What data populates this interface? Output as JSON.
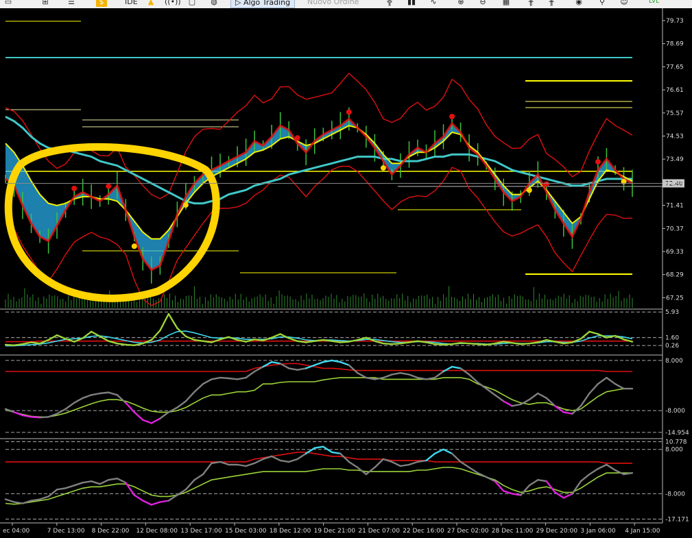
{
  "toolbar": {
    "items": [
      {
        "name": "layout-icon",
        "glyph": "▭"
      },
      {
        "name": "chart-type-icon",
        "glyph": "⊞"
      },
      {
        "name": "database-icon",
        "glyph": "☰"
      },
      {
        "name": "dollar-icon",
        "glyph": "$"
      },
      {
        "name": "ide-button",
        "label": "IDE"
      },
      {
        "name": "lightbulb-icon",
        "glyph": "▲"
      },
      {
        "name": "signal-icon",
        "glyph": "((•))"
      },
      {
        "name": "monitor-icon",
        "glyph": "▢"
      },
      {
        "name": "globe-icon",
        "glyph": "◍"
      },
      {
        "name": "algo-trading-button",
        "label": "▷ Algo Trading"
      },
      {
        "name": "new-order-button",
        "label": "Nuovo Ordine"
      },
      {
        "name": "bar-chart-icon",
        "glyph": "╬"
      },
      {
        "name": "candles-icon",
        "glyph": "▮▮"
      },
      {
        "name": "line-chart-icon",
        "glyph": "∿"
      },
      {
        "name": "zoom-in-icon",
        "glyph": "⊕"
      },
      {
        "name": "zoom-out-icon",
        "glyph": "⊖"
      },
      {
        "name": "tile-icon",
        "glyph": "▦"
      },
      {
        "name": "indicators-icon",
        "glyph": "╫"
      },
      {
        "name": "periods-icon",
        "glyph": "╫"
      },
      {
        "name": "camera-icon",
        "glyph": "◉"
      },
      {
        "name": "search-icon",
        "glyph": "⚲"
      },
      {
        "name": "avatar-icon",
        "glyph": "☺"
      },
      {
        "name": "lvl-label",
        "label": "LVL"
      }
    ]
  },
  "chart_data": [
    {
      "type": "line",
      "pane": "price",
      "y_ticks": [
        "79.73",
        "78.69",
        "77.65",
        "76.61",
        "75.57",
        "74.53",
        "73.49",
        "72.45",
        "71.41",
        "70.37",
        "69.33",
        "68.29",
        "67.25"
      ],
      "current_price": "72.40",
      "ylim": [
        66.8,
        80.1
      ],
      "colors": {
        "price": "#d8d800",
        "envelope": "#e01010",
        "ma_slow": "#40c8c8",
        "ma_fast": "#f0f000",
        "dots": "#e01010",
        "annotation": "#ffd400",
        "volume": "#2e8b2e"
      },
      "series": [
        {
          "values": [
            72.6,
            72.3,
            71.4,
            70.6,
            70.0,
            69.8,
            70.5,
            71.2,
            71.8,
            72.0,
            71.8,
            71.6,
            71.9,
            72.3,
            71.2,
            70.0,
            69.0,
            68.5,
            68.7,
            69.8,
            71.0,
            71.8,
            72.4,
            72.8,
            73.0,
            73.2,
            73.4,
            73.6,
            73.8,
            74.3,
            74.1,
            74.5,
            75.0,
            74.8,
            74.2,
            73.8,
            74.3,
            74.6,
            74.8,
            75.0,
            75.3,
            74.9,
            74.5,
            74.0,
            73.4,
            72.8,
            73.2,
            73.7,
            74.0,
            73.8,
            74.2,
            74.5,
            75.1,
            74.7,
            74.0,
            73.7,
            73.2,
            72.6,
            72.0,
            71.6,
            71.8,
            72.4,
            72.8,
            72.0,
            71.2,
            70.6,
            70.0,
            70.8,
            72.0,
            73.0,
            73.5,
            73.0,
            72.6,
            72.4
          ]
        },
        {
          "values": [
            75.4,
            75.2,
            74.9,
            74.5,
            74.2,
            74.0,
            73.9,
            73.9,
            73.8,
            73.7,
            73.6,
            73.4,
            73.3,
            73.2,
            73.0,
            72.8,
            72.6,
            72.4,
            72.2,
            72.0,
            71.8,
            71.6,
            71.5,
            71.5,
            71.6,
            71.7,
            71.9,
            72.0,
            72.1,
            72.3,
            72.4,
            72.5,
            72.6,
            72.8,
            72.9,
            73.0,
            73.1,
            73.2,
            73.3,
            73.4,
            73.5,
            73.6,
            73.6,
            73.6,
            73.5,
            73.5,
            73.4,
            73.4,
            73.4,
            73.5,
            73.6,
            73.6,
            73.7,
            73.7,
            73.7,
            73.6,
            73.5,
            73.4,
            73.2,
            73.0,
            72.9,
            72.8,
            72.7,
            72.6,
            72.5,
            72.4,
            72.3,
            72.3,
            72.4,
            72.5,
            72.6,
            72.6,
            72.6,
            72.6
          ]
        },
        {
          "values": [
            74.2,
            73.8,
            73.2,
            72.5,
            71.9,
            71.5,
            71.4,
            71.5,
            71.7,
            71.8,
            71.8,
            71.7,
            71.7,
            71.6,
            71.2,
            70.7,
            70.2,
            69.9,
            69.9,
            70.3,
            70.9,
            71.5,
            72.0,
            72.4,
            72.7,
            72.9,
            73.1,
            73.3,
            73.5,
            73.8,
            73.9,
            74.1,
            74.4,
            74.5,
            74.3,
            74.1,
            74.2,
            74.4,
            74.6,
            74.8,
            75.0,
            74.9,
            74.6,
            74.2,
            73.7,
            73.3,
            73.3,
            73.6,
            73.8,
            73.8,
            74.0,
            74.3,
            74.7,
            74.6,
            74.1,
            73.8,
            73.3,
            72.8,
            72.3,
            71.9,
            71.9,
            72.2,
            72.5,
            72.1,
            71.6,
            71.1,
            70.6,
            70.9,
            71.7,
            72.5,
            73.0,
            72.9,
            72.7,
            72.5
          ]
        }
      ]
    },
    {
      "type": "line",
      "pane": "indicator-1",
      "y_ticks": [
        "5.93",
        "1.60",
        "0.26"
      ],
      "ylim": [
        -1.0,
        6.3
      ],
      "series": [
        {
          "values": [
            0.4,
            0.3,
            0.5,
            0.8,
            0.6,
            1.2,
            2.0,
            1.4,
            0.9,
            1.5,
            2.6,
            1.8,
            1.0,
            0.6,
            0.4,
            0.3,
            0.6,
            1.2,
            2.8,
            5.6,
            3.2,
            1.8,
            1.2,
            1.0,
            0.8,
            1.3,
            1.7,
            1.2,
            0.9,
            1.3,
            1.1,
            1.6,
            2.2,
            1.5,
            1.0,
            0.8,
            1.0,
            1.2,
            1.0,
            0.8,
            0.9,
            1.2,
            1.6,
            1.0,
            0.6,
            0.5,
            0.6,
            0.8,
            1.0,
            0.8,
            0.5,
            0.4,
            0.5,
            0.7,
            0.6,
            0.5,
            0.4,
            0.6,
            0.9,
            0.7,
            0.5,
            0.6,
            0.8,
            1.2,
            0.9,
            0.6,
            0.8,
            1.4,
            2.6,
            2.2,
            1.6,
            1.9,
            1.3,
            0.9
          ]
        },
        {
          "values": [
            0.2,
            0.2,
            0.3,
            0.4,
            0.5,
            0.7,
            1.0,
            1.3,
            1.4,
            1.5,
            1.8,
            1.9,
            1.7,
            1.4,
            1.1,
            0.8,
            0.7,
            0.8,
            1.2,
            2.0,
            2.6,
            2.7,
            2.4,
            2.0,
            1.6,
            1.5,
            1.6,
            1.5,
            1.3,
            1.3,
            1.3,
            1.4,
            1.7,
            1.7,
            1.5,
            1.2,
            1.1,
            1.2,
            1.2,
            1.1,
            1.0,
            1.1,
            1.3,
            1.3,
            1.1,
            0.9,
            0.8,
            0.8,
            0.9,
            0.9,
            0.8,
            0.6,
            0.5,
            0.6,
            0.6,
            0.6,
            0.5,
            0.5,
            0.6,
            0.7,
            0.6,
            0.6,
            0.7,
            0.9,
            0.9,
            0.8,
            0.8,
            1.0,
            1.5,
            1.9,
            1.9,
            1.9,
            1.7,
            1.4
          ]
        },
        {
          "values": [
            0.9,
            0.9,
            0.9,
            0.9,
            1.0,
            1.0,
            1.0,
            1.0,
            1.0,
            1.0,
            1.0,
            1.0,
            1.0,
            1.0,
            1.0,
            1.0,
            1.0,
            1.0,
            1.0,
            1.0,
            1.0,
            1.0,
            1.0,
            1.0,
            1.0,
            1.0,
            1.0,
            1.0,
            1.0,
            1.0,
            1.0,
            1.0,
            1.0,
            1.0,
            1.0,
            1.0,
            1.0,
            1.0,
            1.0,
            1.0,
            1.0,
            1.0,
            1.0,
            1.0,
            1.0,
            1.0,
            1.0,
            1.0,
            1.0,
            1.0,
            1.0,
            1.0,
            1.0,
            1.0,
            1.0,
            1.0,
            1.0,
            1.0,
            1.0,
            1.0,
            1.0,
            1.0,
            1.0,
            1.0,
            1.0,
            1.0,
            1.0,
            1.0,
            1.0,
            1.0,
            1.0,
            1.0,
            1.0,
            1.0
          ]
        }
      ]
    },
    {
      "type": "line",
      "pane": "indicator-2",
      "y_ticks": [
        "8.000",
        "-8.000",
        "-14.954"
      ],
      "ylim": [
        -16.5,
        9.3
      ],
      "series": [
        {
          "values": [
            -7.5,
            -8.5,
            -9.5,
            -10.0,
            -10.2,
            -10.0,
            -9.0,
            -7.5,
            -5.5,
            -4.0,
            -3.0,
            -2.5,
            -2.2,
            -3.0,
            -5.5,
            -8.5,
            -11.0,
            -12.0,
            -10.5,
            -8.5,
            -7.0,
            -5.0,
            -2.0,
            0.5,
            2.0,
            2.5,
            2.3,
            2.0,
            2.5,
            4.5,
            6.0,
            7.5,
            7.0,
            5.5,
            5.0,
            5.5,
            6.5,
            7.5,
            8.0,
            7.5,
            6.5,
            4.0,
            2.5,
            2.0,
            2.5,
            3.5,
            4.0,
            3.5,
            2.5,
            2.0,
            2.5,
            4.5,
            6.0,
            5.5,
            3.5,
            1.0,
            -1.0,
            -3.0,
            -5.0,
            -6.5,
            -6.0,
            -4.5,
            -2.5,
            -4.0,
            -6.5,
            -8.5,
            -9.0,
            -6.5,
            -2.5,
            0.5,
            2.5,
            0.5,
            -1.0,
            -1.0
          ]
        },
        {
          "values": [
            -7.8,
            -8.5,
            -9.2,
            -9.8,
            -10.0,
            -10.0,
            -9.5,
            -8.8,
            -7.8,
            -6.8,
            -5.8,
            -5.0,
            -4.5,
            -4.5,
            -5.0,
            -6.0,
            -7.2,
            -8.2,
            -8.5,
            -8.5,
            -8.0,
            -7.0,
            -5.5,
            -4.0,
            -3.0,
            -3.0,
            -2.5,
            -2.0,
            -2.0,
            -1.5,
            0.5,
            0.5,
            1.0,
            1.2,
            1.2,
            1.2,
            1.2,
            1.8,
            2.2,
            2.5,
            2.5,
            2.5,
            2.5,
            2.5,
            2.0,
            2.0,
            2.0,
            2.0,
            2.0,
            2.0,
            2.0,
            2.5,
            2.5,
            2.5,
            2.0,
            0.5,
            -0.5,
            -1.5,
            -3.0,
            -4.5,
            -5.5,
            -6.0,
            -5.5,
            -5.5,
            -6.5,
            -7.5,
            -8.0,
            -7.5,
            -5.5,
            -3.5,
            -2.0,
            -1.5,
            -1.0,
            -1.0
          ]
        },
        {
          "values": [
            4.5,
            4.5,
            4.5,
            4.5,
            4.5,
            4.5,
            4.5,
            4.5,
            4.5,
            4.5,
            4.5,
            4.5,
            4.5,
            4.5,
            4.5,
            4.5,
            4.5,
            4.5,
            4.5,
            4.5,
            4.5,
            4.5,
            4.5,
            4.5,
            4.5,
            4.5,
            4.5,
            4.5,
            4.5,
            5.5,
            6.0,
            6.5,
            6.8,
            7.0,
            7.0,
            6.5,
            6.0,
            5.5,
            5.5,
            5.3,
            5.0,
            4.8,
            4.8,
            4.8,
            4.8,
            4.8,
            4.8,
            4.8,
            4.8,
            4.8,
            4.8,
            4.8,
            4.8,
            4.8,
            4.8,
            4.8,
            4.8,
            4.8,
            4.8,
            4.8,
            4.8,
            4.8,
            4.8,
            4.8,
            4.8,
            4.8,
            4.8,
            4.8,
            4.8,
            4.8,
            4.5,
            4.5,
            4.5,
            4.5
          ]
        }
      ]
    },
    {
      "type": "line",
      "pane": "indicator-3",
      "y_ticks": [
        "10.778",
        "8.000",
        "-8.000",
        "-17.171"
      ],
      "ylim": [
        -18.3,
        11.4
      ],
      "series": [
        {
          "values": [
            -10.0,
            -11.0,
            -11.5,
            -10.5,
            -10.0,
            -9.0,
            -6.5,
            -6.0,
            -5.0,
            -4.0,
            -3.5,
            -4.5,
            -3.0,
            -2.5,
            -4.0,
            -8.5,
            -10.5,
            -12.0,
            -11.0,
            -10.5,
            -8.5,
            -6.5,
            -3.0,
            -1.0,
            3.0,
            3.5,
            2.5,
            2.5,
            2.0,
            3.0,
            4.5,
            5.5,
            4.0,
            3.5,
            4.5,
            6.5,
            8.5,
            9.0,
            7.0,
            6.5,
            3.5,
            1.5,
            -1.0,
            1.5,
            4.5,
            3.5,
            2.0,
            2.5,
            3.5,
            4.0,
            6.5,
            8.0,
            6.5,
            3.5,
            1.5,
            -0.5,
            -2.0,
            -3.5,
            -7.0,
            -8.0,
            -8.5,
            -5.0,
            -3.0,
            -3.5,
            -7.5,
            -9.5,
            -8.0,
            -3.5,
            -1.0,
            1.0,
            2.5,
            0.5,
            -1.0,
            -0.5
          ]
        },
        {
          "values": [
            -11.5,
            -11.8,
            -11.5,
            -11.0,
            -10.5,
            -10.0,
            -9.0,
            -8.0,
            -7.0,
            -6.0,
            -5.5,
            -5.5,
            -5.0,
            -4.5,
            -4.5,
            -5.5,
            -7.0,
            -8.5,
            -9.0,
            -9.0,
            -8.5,
            -7.5,
            -6.0,
            -4.5,
            -3.0,
            -2.5,
            -2.0,
            -1.5,
            -1.0,
            -0.5,
            0.0,
            0.0,
            0.0,
            0.0,
            0.0,
            0.0,
            0.5,
            1.0,
            1.0,
            1.0,
            0.5,
            0.5,
            0.0,
            0.0,
            0.0,
            0.0,
            0.0,
            0.0,
            0.5,
            0.5,
            1.0,
            1.5,
            1.5,
            1.0,
            0.0,
            -1.0,
            -2.0,
            -3.0,
            -5.0,
            -6.5,
            -7.5,
            -7.0,
            -6.0,
            -5.5,
            -6.5,
            -7.5,
            -7.5,
            -6.0,
            -4.0,
            -2.0,
            -0.5,
            -0.5,
            -0.5,
            -0.5
          ]
        },
        {
          "values": [
            3.5,
            3.5,
            3.5,
            3.5,
            3.5,
            3.5,
            3.5,
            3.5,
            3.5,
            3.5,
            3.5,
            3.5,
            3.5,
            3.5,
            3.5,
            3.5,
            3.5,
            3.5,
            3.5,
            3.5,
            3.5,
            3.5,
            3.5,
            3.5,
            3.5,
            3.5,
            3.5,
            3.5,
            3.5,
            4.5,
            5.0,
            5.5,
            6.0,
            6.5,
            7.0,
            7.0,
            6.5,
            6.0,
            5.5,
            5.5,
            5.0,
            4.5,
            4.5,
            4.5,
            4.5,
            4.0,
            4.0,
            4.0,
            4.0,
            4.0,
            3.5,
            3.5,
            3.5,
            3.5,
            3.5,
            3.5,
            3.5,
            3.5,
            3.5,
            3.5,
            3.5,
            3.5,
            3.5,
            3.5,
            3.5,
            3.5,
            3.5,
            3.5,
            3.5,
            3.5,
            3.0,
            3.0,
            3.0,
            3.0
          ]
        }
      ]
    }
  ],
  "x_axis": {
    "categories": [
      "ec 04:00",
      "7 Dec 13:00",
      "8 Dec 22:00",
      "12 Dec 08:00",
      "13 Dec 17:00",
      "15 Dec 03:00",
      "18 Dec 12:00",
      "19 Dec 21:00",
      "21 Dec 07:00",
      "22 Dec 16:00",
      "27 Dec 02:00",
      "28 Dec 11:00",
      "29 Dec 20:00",
      "3 Jan 06:00",
      "4 Jan 15:00"
    ]
  }
}
